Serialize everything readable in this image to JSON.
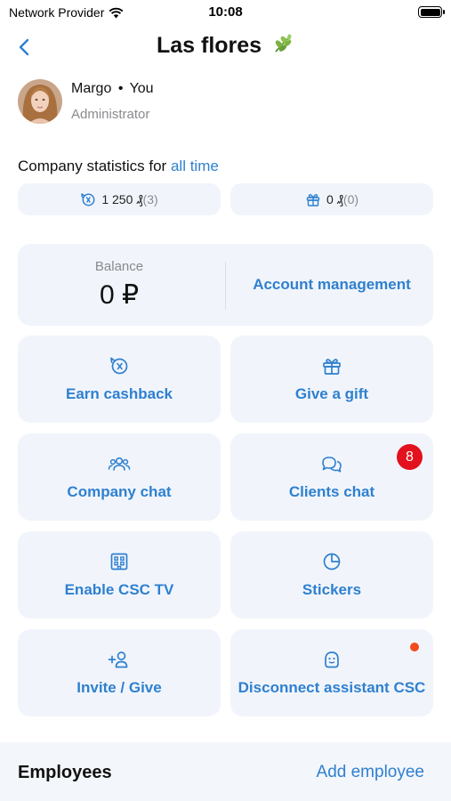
{
  "status": {
    "carrier": "Network Provider",
    "time": "10:08"
  },
  "nav": {
    "title": "Las flores"
  },
  "profile": {
    "name": "Margo",
    "separator": "•",
    "you": "You",
    "role": "Administrator"
  },
  "stats": {
    "heading": "Company statistics for",
    "period_link": "all time",
    "cashback_value": "1 250 ₰",
    "cashback_count": "(3)",
    "gift_value": "0 ₰",
    "gift_count": "(0)"
  },
  "balance": {
    "label": "Balance",
    "value": "0 ₽",
    "account_management": "Account management"
  },
  "actions": {
    "earn_cashback": "Earn cashback",
    "give_gift": "Give a gift",
    "company_chat": "Company chat",
    "clients_chat": "Clients chat",
    "clients_chat_badge": "8",
    "enable_tv": "Enable CSC TV",
    "stickers": "Stickers",
    "invite": "Invite / Give",
    "disconnect_assistant": "Disconnect assistant CSC"
  },
  "employees": {
    "title": "Employees",
    "add_label": "Add employee"
  },
  "colors": {
    "accent": "#2f80d0",
    "card_bg": "#f1f5fb",
    "badge": "#e3111d",
    "dot": "#f04c1c"
  }
}
